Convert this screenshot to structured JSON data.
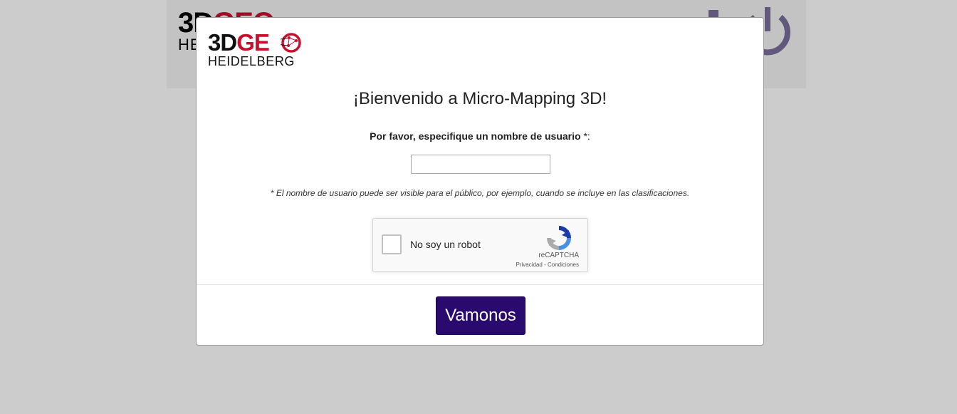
{
  "background": {
    "logo_top_left": "3D",
    "logo_top_right": "GEO",
    "logo_bottom": "HE"
  },
  "logo": {
    "part1": "3D",
    "part2": "GE",
    "line2": "HEIDELBERG"
  },
  "modal": {
    "title": "¡Bienvenido a Micro-Mapping 3D!",
    "username_label": "Por favor, especifique un nombre de usuario",
    "username_required_mark": "*:",
    "username_value": "",
    "note": "* El nombre de usuario puede ser visible para el público, por ejemplo, cuando se incluye en las clasificaciones.",
    "captcha": {
      "label": "No soy un robot",
      "brand": "reCAPTCHA",
      "links": "Privacidad - Condiciones"
    },
    "submit_label": "Vamonos"
  },
  "colors": {
    "accent": "#2a0a6e",
    "logo_red": "#c8102e",
    "overlay": "rgba(0,0,0,0.2)"
  }
}
